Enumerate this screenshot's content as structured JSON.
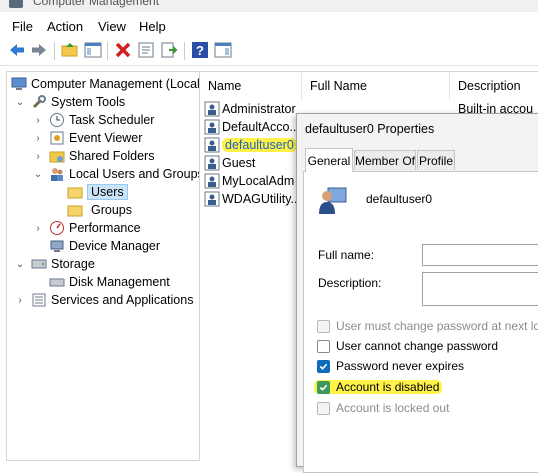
{
  "window": {
    "title": "Computer Management"
  },
  "menu": [
    "File",
    "Action",
    "View",
    "Help"
  ],
  "toolbar": [
    "back-icon",
    "forward-icon",
    "up-folder-icon",
    "show-hide-tree-icon",
    "delete-icon",
    "properties-icon",
    "export-list-icon",
    "help-icon",
    "show-hide-action-pane-icon"
  ],
  "tree": {
    "root": "Computer Management (Local",
    "system_tools": "System Tools",
    "task_scheduler": "Task Scheduler",
    "event_viewer": "Event Viewer",
    "shared_folders": "Shared Folders",
    "local_users_groups": "Local Users and Groups",
    "users": "Users",
    "groups": "Groups",
    "performance": "Performance",
    "device_manager": "Device Manager",
    "storage": "Storage",
    "disk_management": "Disk Management",
    "services_apps": "Services and Applications"
  },
  "list": {
    "columns": [
      "Name",
      "Full Name",
      "Description"
    ],
    "rows": [
      {
        "name": "Administrator",
        "description": "Built-in accou"
      },
      {
        "name": "DefaultAcco..."
      },
      {
        "name": "defaultuser0"
      },
      {
        "name": "Guest"
      },
      {
        "name": "MyLocalAdm"
      },
      {
        "name": "WDAGUtility..."
      }
    ]
  },
  "dialog": {
    "title": "defaultuser0 Properties",
    "tabs": [
      "General",
      "Member Of",
      "Profile"
    ],
    "active_tab": "General",
    "username": "defaultuser0",
    "full_name_label": "Full name:",
    "full_name_value": "",
    "description_label": "Description:",
    "description_value": "",
    "options": [
      {
        "label": "User must change password at next logon",
        "checked": false,
        "disabled": true
      },
      {
        "label": "User cannot change password",
        "checked": false,
        "disabled": false
      },
      {
        "label": "Password never expires",
        "checked": true,
        "disabled": false
      },
      {
        "label": "Account is disabled",
        "checked": true,
        "disabled": false
      },
      {
        "label": "Account is locked out",
        "checked": false,
        "disabled": true
      }
    ]
  },
  "colors": {
    "highlight": "#fff34a",
    "accent": "#0f6cbd",
    "selection": "#cce4f7"
  }
}
